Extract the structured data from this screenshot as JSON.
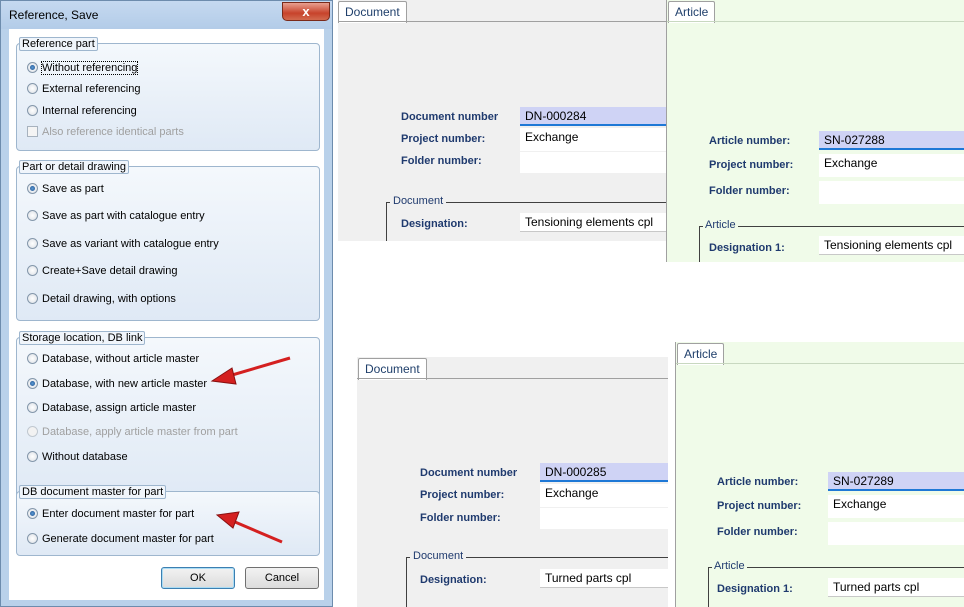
{
  "dialog": {
    "title": "Reference, Save",
    "close_glyph": "x",
    "groups": {
      "reference_part": {
        "legend": "Reference part",
        "options": [
          {
            "label": "Without referencing",
            "selected": true
          },
          {
            "label": "External referencing",
            "selected": false
          },
          {
            "label": "Internal referencing",
            "selected": false
          }
        ],
        "checkbox": {
          "label": "Also reference identical parts",
          "checked": false,
          "enabled": false
        }
      },
      "part_or_detail": {
        "legend": "Part or detail drawing",
        "options": [
          {
            "label": "Save as part",
            "selected": true
          },
          {
            "label": "Save as part with catalogue entry",
            "selected": false
          },
          {
            "label": "Save as variant with catalogue entry",
            "selected": false
          },
          {
            "label": "Create+Save detail drawing",
            "selected": false
          },
          {
            "label": "Detail drawing, with options",
            "selected": false
          }
        ]
      },
      "storage": {
        "legend": "Storage location, DB link",
        "options": [
          {
            "label": "Database, without article master",
            "selected": false
          },
          {
            "label": "Database, with new article master",
            "selected": true
          },
          {
            "label": "Database, assign article master",
            "selected": false
          },
          {
            "label": "Database, apply article master from part",
            "selected": false
          },
          {
            "label": "Without database",
            "selected": false
          }
        ]
      },
      "doc_master": {
        "legend": "DB document master for part",
        "options": [
          {
            "label": "Enter document master for part",
            "selected": true
          },
          {
            "label": "Generate document master for part",
            "selected": false
          }
        ]
      }
    },
    "buttons": {
      "ok": "OK",
      "cancel": "Cancel"
    },
    "annotation_color": "#d42020"
  },
  "panels": [
    {
      "document": {
        "tab": "Document",
        "document_number_label": "Document number",
        "document_number": "DN-000284",
        "project_number_label": "Project number:",
        "project_number": "Exchange",
        "folder_number_label": "Folder number:",
        "folder_number": "",
        "section": "Document",
        "designation_label": "Designation:",
        "designation": "Tensioning elements cpl"
      },
      "article": {
        "tab": "Article",
        "article_number_label": "Article number:",
        "article_number": "SN-027288",
        "project_number_label": "Project number:",
        "project_number": "Exchange",
        "folder_number_label": "Folder number:",
        "folder_number": "",
        "section": "Article",
        "designation1_label": "Designation 1:",
        "designation1": "Tensioning elements cpl"
      }
    },
    {
      "document": {
        "tab": "Document",
        "document_number_label": "Document number",
        "document_number": "DN-000285",
        "project_number_label": "Project number:",
        "project_number": "Exchange",
        "folder_number_label": "Folder number:",
        "folder_number": "",
        "section": "Document",
        "designation_label": "Designation:",
        "designation": "Turned parts cpl"
      },
      "article": {
        "tab": "Article",
        "article_number_label": "Article number:",
        "article_number": "SN-027289",
        "project_number_label": "Project number:",
        "project_number": "Exchange",
        "folder_number_label": "Folder number:",
        "folder_number": "",
        "section": "Article",
        "designation1_label": "Designation 1:",
        "designation1": "Turned parts cpl"
      }
    }
  ]
}
